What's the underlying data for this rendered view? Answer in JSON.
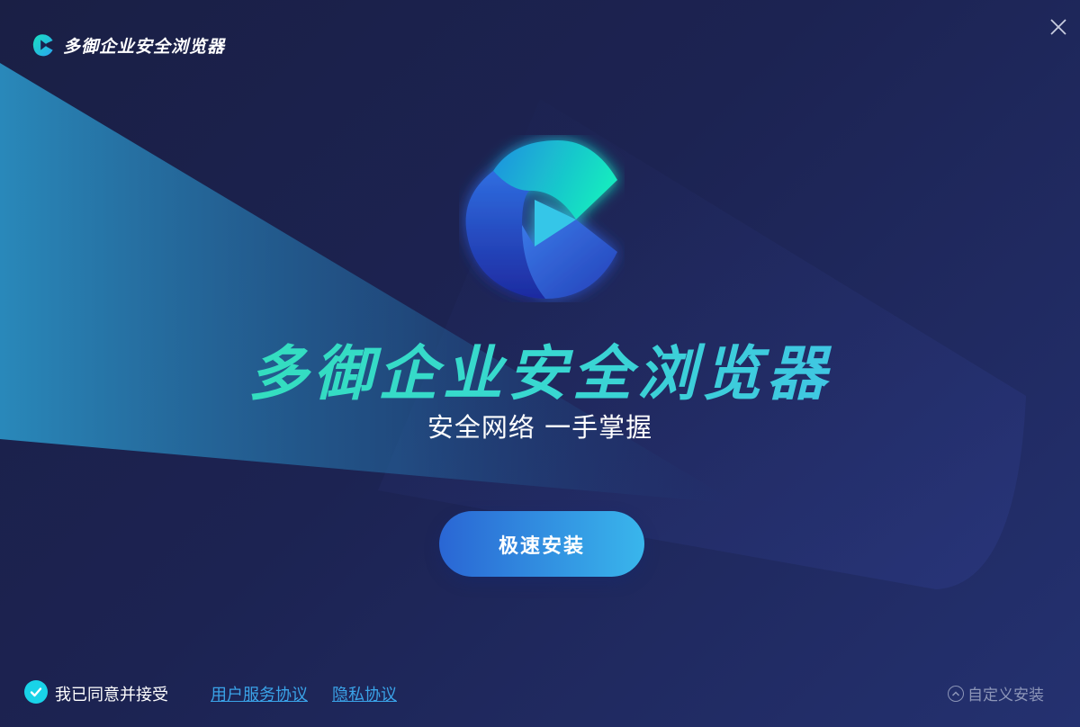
{
  "window": {
    "app_name": "多御企业安全浏览器",
    "close_icon": "close-icon"
  },
  "hero": {
    "title": "多御企业安全浏览器",
    "subtitle": "安全网络 一手掌握",
    "logo_icon": "browser-logo-icon"
  },
  "actions": {
    "install_label": "极速安装"
  },
  "footer": {
    "agree_checked": true,
    "agree_label": "我已同意并接受",
    "user_agreement_link": "用户服务协议",
    "privacy_link": "隐私协议",
    "custom_install_label": "自定义安装",
    "custom_install_icon": "chevron-up-circle-icon"
  },
  "colors": {
    "background": "#1c2352",
    "accent_green": "#2fe3b0",
    "accent_blue": "#39b6ec",
    "link": "#3aa3e8",
    "checkbox": "#19d3e8"
  }
}
